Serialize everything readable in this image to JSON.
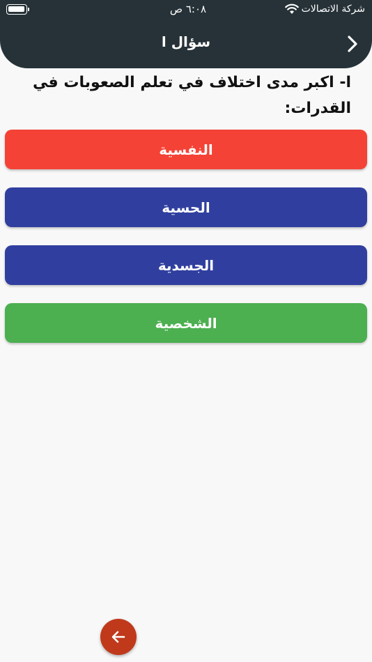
{
  "status_bar": {
    "time": "٦:٠٨ ص",
    "carrier": "شركة الاتصالات",
    "icons": [
      "battery-icon",
      "wifi-icon"
    ]
  },
  "header": {
    "title": "سؤال ا",
    "back_icon": "chevron-right-icon"
  },
  "question": {
    "text": "ا- اكبر مدى اختلاف في تعلم الصعوبات في القدرات:"
  },
  "options": [
    {
      "label": "النفسية",
      "color": "#f44336"
    },
    {
      "label": "الحسية",
      "color": "#303f9f"
    },
    {
      "label": "الجسدية",
      "color": "#303f9f"
    },
    {
      "label": "الشخصية",
      "color": "#4caf50"
    }
  ],
  "fab": {
    "icon": "arrow-left-icon",
    "color": "#c0391b"
  },
  "colors": {
    "header_bg": "#263238",
    "page_bg": "#f8f8f8"
  }
}
